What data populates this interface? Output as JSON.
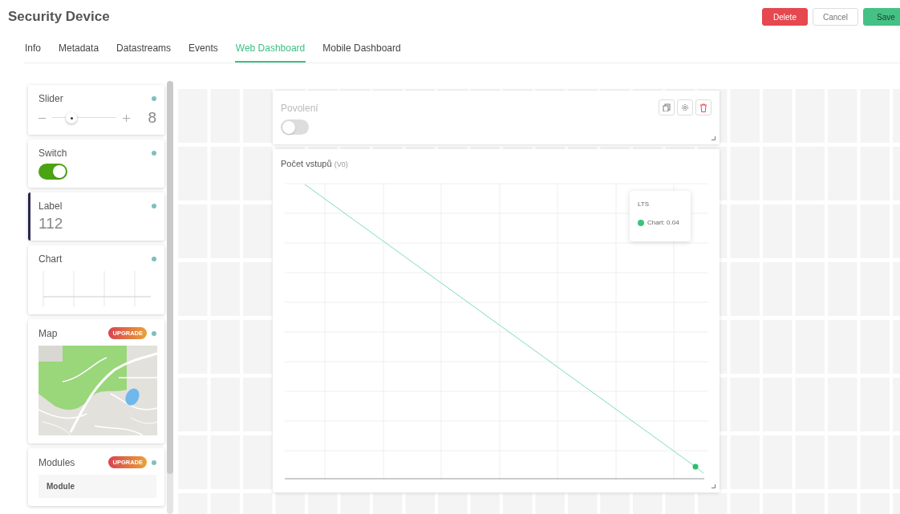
{
  "header": {
    "title": "Security Device",
    "buttons": [
      {
        "label": "Delete",
        "kind": "danger"
      },
      {
        "label": "Cancel",
        "kind": "default"
      },
      {
        "label": "Save",
        "kind": "primary"
      }
    ]
  },
  "tabs": [
    {
      "label": "Info",
      "selected": false
    },
    {
      "label": "Metadata",
      "selected": false
    },
    {
      "label": "Datastreams",
      "selected": false
    },
    {
      "label": "Events",
      "selected": false
    },
    {
      "label": "Web Dashboard",
      "selected": true
    },
    {
      "label": "Mobile Dashboard",
      "selected": false
    }
  ],
  "widget_list": [
    {
      "kind": "slider",
      "title": "Slider",
      "level": 0.3,
      "value": "8",
      "selected": false
    },
    {
      "kind": "switch",
      "title": "Switch",
      "on": true,
      "selected": false
    },
    {
      "kind": "label",
      "title": "Label",
      "value": "112",
      "selected": true
    },
    {
      "kind": "chart",
      "title": "Chart",
      "selected": false
    },
    {
      "kind": "map",
      "title": "Map",
      "badge": "UPGRADE",
      "selected": false
    },
    {
      "kind": "modules",
      "title": "Modules",
      "badge": "UPGRADE",
      "items": [
        "Module"
      ],
      "selected": false
    }
  ],
  "dashboard": {
    "widgets": [
      {
        "kind": "switch",
        "title": "Povolení",
        "on": false
      },
      {
        "kind": "chart",
        "title": "Počet vstupů",
        "pin": "(V0)",
        "tooltip": {
          "title": "LTS",
          "series": "Chart: 0.04"
        }
      }
    ]
  }
}
